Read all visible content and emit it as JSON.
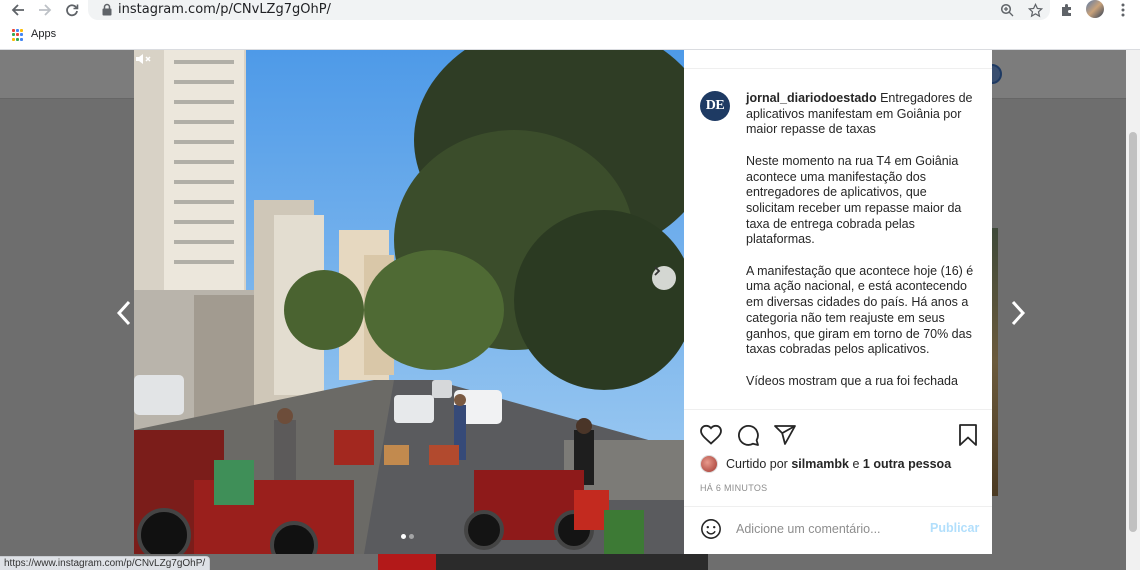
{
  "browser": {
    "url": "instagram.com/p/CNvLZg7gOhP/",
    "bookmarks_apps_label": "Apps",
    "status_url": "https://www.instagram.com/p/CNvLZg7gOhP/"
  },
  "post": {
    "account": "jornal_diariodoestado",
    "avatar_text": "DE",
    "caption_title": "Entregadores de aplicativos manifestam em Goiânia por maior repasse de taxas",
    "caption_paragraphs": [
      "Neste momento na rua T4 em Goiânia acontece uma manifestação dos entregadores de aplicativos, que solicitam receber um repasse maior da taxa de entrega cobrada pelas plataformas.",
      "A manifestação que acontece hoje (16) é uma ação nacional, e está acontecendo em diversas cidades do país. Há anos a categoria não tem reajuste em seus ganhos, que giram em torno de 70% das taxas cobradas pelos aplicativos.",
      "Vídeos mostram que a rua foi fechada"
    ],
    "likes": {
      "prefix": "Curtido por",
      "user": "silmambk",
      "joiner": "e",
      "others": "1 outra pessoa"
    },
    "timestamp": "HÁ 6 MINUTOS",
    "comment_placeholder": "Adicione um comentário...",
    "publish_label": "Publicar",
    "carousel": {
      "total": 2,
      "active": 1
    }
  },
  "colors": {
    "brand_navy": "#1e3a63",
    "publish_disabled": "#b2dffc",
    "muted_text": "#8e8e8e"
  }
}
